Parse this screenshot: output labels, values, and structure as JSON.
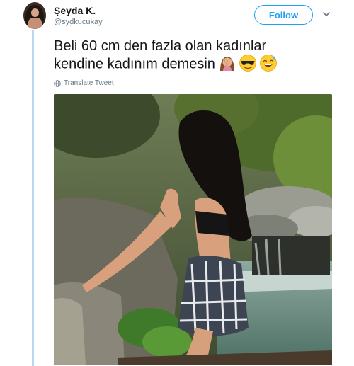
{
  "author": {
    "display_name": "Şeyda K.",
    "handle": "@sydkucukay"
  },
  "actions": {
    "follow_label": "Follow",
    "more_icon": "chevron-down-icon"
  },
  "tweet": {
    "text_line_1": "Beli 60 cm den fazla olan kadınlar",
    "text_line_2": "kendine kadınım demesin",
    "emojis": [
      "facepalm-woman-emoji",
      "sunglasses-face-emoji",
      "sweat-smile-emoji"
    ]
  },
  "translate": {
    "icon": "globe-icon",
    "label": "Translate Tweet"
  },
  "colors": {
    "accent": "#1da1f2",
    "thread_line": "#b8d8f2",
    "secondary_text": "#657786"
  }
}
